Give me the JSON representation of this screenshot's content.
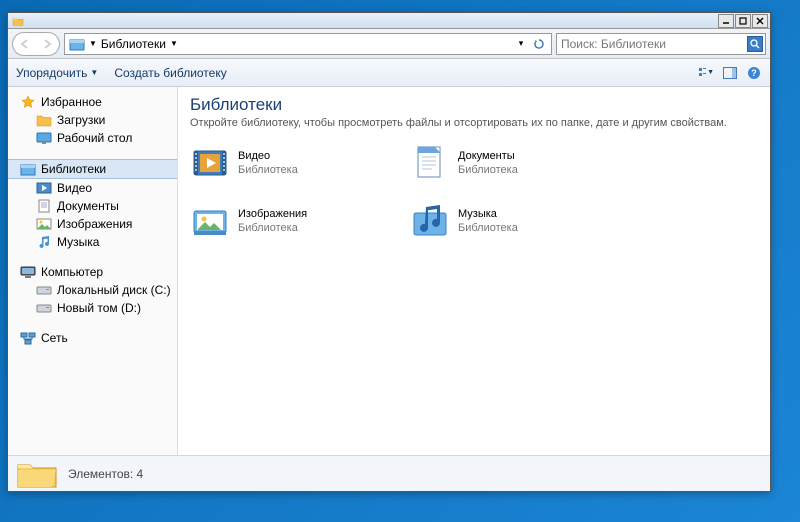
{
  "breadcrumb": "Библиотеки",
  "search_placeholder": "Поиск: Библиотеки",
  "toolbar": {
    "organize": "Упорядочить",
    "new_lib": "Создать библиотеку"
  },
  "sidebar": {
    "favorites": {
      "label": "Избранное",
      "items": [
        "Загрузки",
        "Рабочий стол"
      ]
    },
    "libraries": {
      "label": "Библиотеки",
      "items": [
        "Видео",
        "Документы",
        "Изображения",
        "Музыка"
      ]
    },
    "computer": {
      "label": "Компьютер",
      "items": [
        "Локальный диск (C:)",
        "Новый том (D:)"
      ]
    },
    "network": {
      "label": "Сеть"
    }
  },
  "main": {
    "title": "Библиотеки",
    "subtitle": "Откройте библиотеку, чтобы просмотреть файлы и отсортировать их по папке, дате и другим свойствам.",
    "items": [
      {
        "name": "Видео",
        "sub": "Библиотека"
      },
      {
        "name": "Документы",
        "sub": "Библиотека"
      },
      {
        "name": "Изображения",
        "sub": "Библиотека"
      },
      {
        "name": "Музыка",
        "sub": "Библиотека"
      }
    ]
  },
  "status": {
    "label": "Элементов: 4"
  }
}
